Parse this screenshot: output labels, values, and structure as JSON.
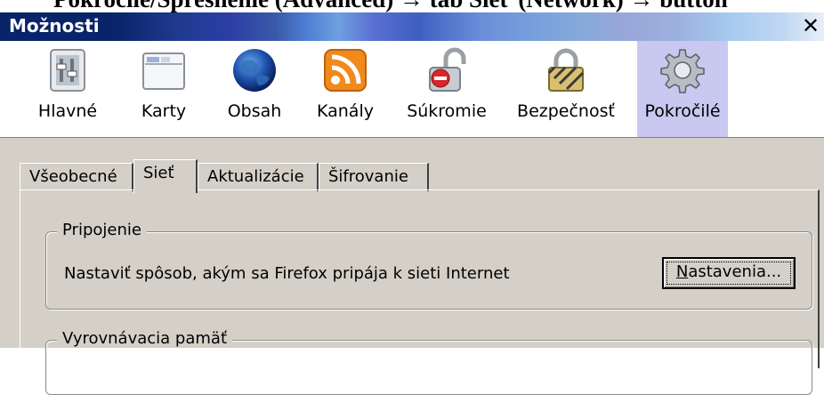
{
  "caption": "Pokročilé/Spresnenie (Advanced) → tab Sieť (Network) → button",
  "window": {
    "title": "Možnosti",
    "close_glyph": "✕"
  },
  "toolbar": {
    "items": [
      {
        "label": "Hlavné",
        "icon": "main-switch-icon"
      },
      {
        "label": "Karty",
        "icon": "tabs-window-icon"
      },
      {
        "label": "Obsah",
        "icon": "globe-icon"
      },
      {
        "label": "Kanály",
        "icon": "rss-feed-icon"
      },
      {
        "label": "Súkromie",
        "icon": "privacy-lock-icon"
      },
      {
        "label": "Bezpečnosť",
        "icon": "security-padlock-icon"
      },
      {
        "label": "Pokročilé",
        "icon": "gear-icon",
        "selected": true
      }
    ]
  },
  "tabs": [
    {
      "label": "Všeobecné"
    },
    {
      "label": "Sieť",
      "active": true
    },
    {
      "label": "Aktualizácie"
    },
    {
      "label": "Šifrovanie"
    }
  ],
  "connection": {
    "legend": "Pripojenie",
    "description": "Nastaviť spôsob, akým sa Firefox pripája k sieti Internet",
    "button_first": "N",
    "button_rest": "astavenia..."
  },
  "cache": {
    "legend": "Vyrovnávacia pamäť"
  },
  "colors": {
    "title_start": "#0a246a",
    "dialog_bg": "#d4d0c8",
    "selected_tool": "#c8c8f0",
    "rss_orange": "#f08a1c"
  }
}
